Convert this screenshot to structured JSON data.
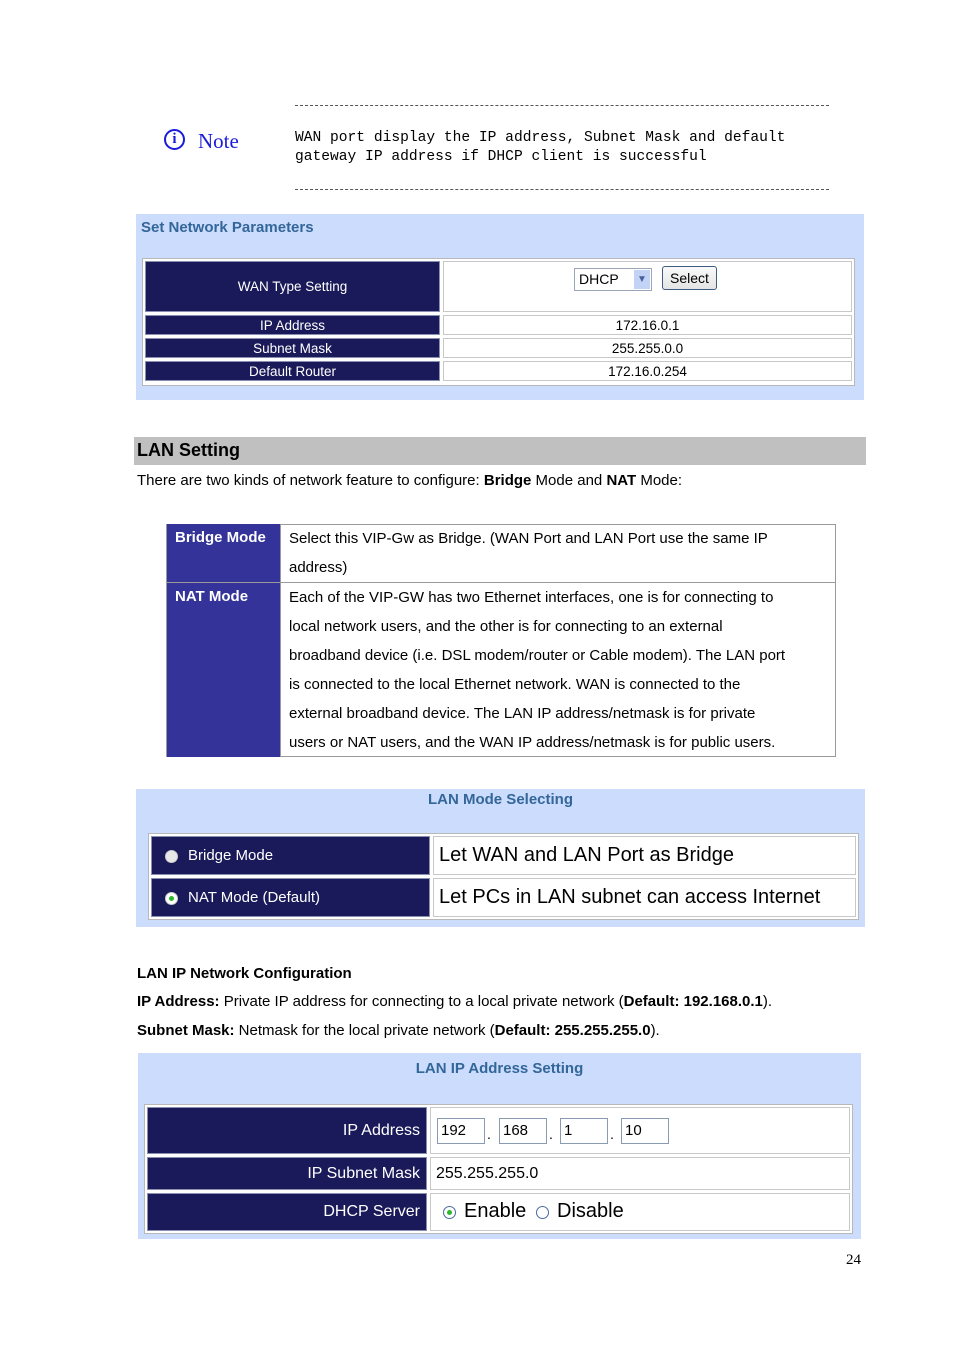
{
  "note": {
    "icon": "info-icon",
    "label": "Note",
    "text_line1": "WAN port display the IP address, Subnet Mask and default",
    "text_line2": "gateway IP address if DHCP client is successful"
  },
  "network_params": {
    "title": "Set Network Parameters",
    "wan_type_label": "WAN Type Setting",
    "wan_type_value": "DHCP",
    "select_button": "Select",
    "rows": [
      {
        "label": "IP Address",
        "value": "172.16.0.1"
      },
      {
        "label": "Subnet Mask",
        "value": "255.255.0.0"
      },
      {
        "label": "Default Router",
        "value": "172.16.0.254"
      }
    ]
  },
  "lan_setting": {
    "title": "LAN Setting",
    "intro_prefix": "There are two kinds of network feature to configure: ",
    "intro_bold1": "Bridge",
    "intro_mid": " Mode and ",
    "intro_bold2": "NAT",
    "intro_suffix": " Mode:",
    "modes": [
      {
        "name": "Bridge Mode",
        "lines": [
          "Select this VIP-Gw as Bridge. (WAN Port and LAN Port use the same IP",
          "address)"
        ]
      },
      {
        "name": "NAT Mode",
        "lines": [
          "Each of the VIP-GW has two Ethernet interfaces, one is for connecting to",
          "local network users, and the other is for connecting to an external",
          "broadband device (i.e. DSL modem/router or Cable modem). The LAN port",
          "is connected to the local Ethernet network. WAN is connected to the",
          "external broadband device. The LAN IP address/netmask is for private",
          "users or NAT users, and the WAN IP address/netmask is for public users."
        ]
      }
    ]
  },
  "lan_mode_selecting": {
    "title": "LAN Mode Selecting",
    "options": [
      {
        "label": "Bridge Mode",
        "description": "Let WAN and LAN Port as Bridge",
        "selected": false
      },
      {
        "label": "NAT Mode (Default)",
        "description": "Let PCs in LAN subnet can access Internet",
        "selected": true
      }
    ]
  },
  "lan_ip_config": {
    "heading": "LAN IP Network Configuration",
    "ip_label": "IP Address:",
    "ip_text": " Private IP address for connecting to a local private network (",
    "ip_default": "Default: 192.168.0.1",
    "ip_end": ").",
    "mask_label": "Subnet Mask:",
    "mask_text": " Netmask for the local private network (",
    "mask_default": "Default: 255.255.255.0",
    "mask_end": ")."
  },
  "lan_ip_setting": {
    "title": "LAN IP Address Setting",
    "ip_label": "IP Address",
    "ip_octets": [
      "192",
      "168",
      "1",
      "10"
    ],
    "mask_label": "IP Subnet Mask",
    "mask_value": "255.255.255.0",
    "dhcp_label": "DHCP Server",
    "dhcp_enable": "Enable",
    "dhcp_disable": "Disable",
    "dhcp_selected": "Enable"
  },
  "page_number": "24"
}
